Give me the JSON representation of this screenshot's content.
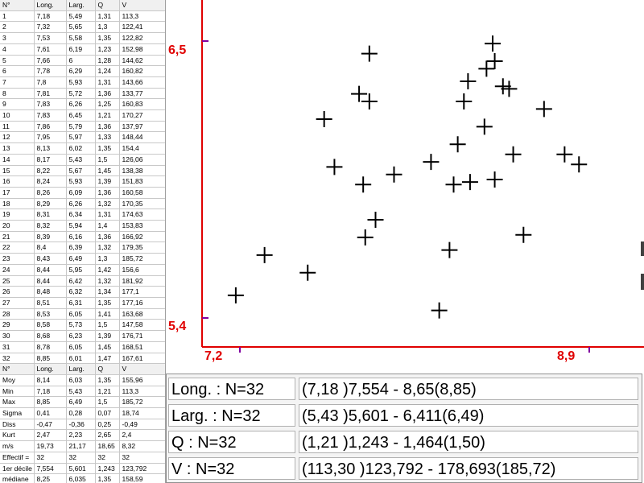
{
  "grid": {
    "header": [
      "N°",
      "Long.",
      "Larg.",
      "Q",
      "V"
    ],
    "rows": [
      [
        "1",
        "7,18",
        "5,49",
        "1,31",
        "113,3"
      ],
      [
        "2",
        "7,32",
        "5,65",
        "1,3",
        "122,41"
      ],
      [
        "3",
        "7,53",
        "5,58",
        "1,35",
        "122,82"
      ],
      [
        "4",
        "7,61",
        "6,19",
        "1,23",
        "152,98"
      ],
      [
        "5",
        "7,66",
        "6",
        "1,28",
        "144,62"
      ],
      [
        "6",
        "7,78",
        "6,29",
        "1,24",
        "160,82"
      ],
      [
        "7",
        "7,8",
        "5,93",
        "1,31",
        "143,66"
      ],
      [
        "8",
        "7,81",
        "5,72",
        "1,36",
        "133,77"
      ],
      [
        "9",
        "7,83",
        "6,26",
        "1,25",
        "160,83"
      ],
      [
        "10",
        "7,83",
        "6,45",
        "1,21",
        "170,27"
      ],
      [
        "11",
        "7,86",
        "5,79",
        "1,36",
        "137,97"
      ],
      [
        "12",
        "7,95",
        "5,97",
        "1,33",
        "148,44"
      ],
      [
        "13",
        "8,13",
        "6,02",
        "1,35",
        "154,4"
      ],
      [
        "14",
        "8,17",
        "5,43",
        "1,5",
        "126,06"
      ],
      [
        "15",
        "8,22",
        "5,67",
        "1,45",
        "138,38"
      ],
      [
        "16",
        "8,24",
        "5,93",
        "1,39",
        "151,83"
      ],
      [
        "17",
        "8,26",
        "6,09",
        "1,36",
        "160,58"
      ],
      [
        "18",
        "8,29",
        "6,26",
        "1,32",
        "170,35"
      ],
      [
        "19",
        "8,31",
        "6,34",
        "1,31",
        "174,63"
      ],
      [
        "20",
        "8,32",
        "5,94",
        "1,4",
        "153,83"
      ],
      [
        "21",
        "8,39",
        "6,16",
        "1,36",
        "166,92"
      ],
      [
        "22",
        "8,4",
        "6,39",
        "1,32",
        "179,35"
      ],
      [
        "23",
        "8,43",
        "6,49",
        "1,3",
        "185,72"
      ],
      [
        "24",
        "8,44",
        "5,95",
        "1,42",
        "156,6"
      ],
      [
        "25",
        "8,44",
        "6,42",
        "1,32",
        "181,92"
      ],
      [
        "26",
        "8,48",
        "6,32",
        "1,34",
        "177,1"
      ],
      [
        "27",
        "8,51",
        "6,31",
        "1,35",
        "177,16"
      ],
      [
        "28",
        "8,53",
        "6,05",
        "1,41",
        "163,68"
      ],
      [
        "29",
        "8,58",
        "5,73",
        "1,5",
        "147,58"
      ],
      [
        "30",
        "8,68",
        "6,23",
        "1,39",
        "176,71"
      ],
      [
        "31",
        "8,78",
        "6,05",
        "1,45",
        "168,51"
      ],
      [
        "32",
        "8,85",
        "6,01",
        "1,47",
        "167,61"
      ]
    ],
    "stats_header": [
      "N°",
      "Long.",
      "Larg.",
      "Q",
      "V"
    ],
    "stats_rows": [
      [
        "Moy",
        "8,14",
        "6,03",
        "1,35",
        "155,96"
      ],
      [
        "Min",
        "7,18",
        "5,43",
        "1,21",
        "113,3"
      ],
      [
        "Max",
        "8,85",
        "6,49",
        "1,5",
        "185,72"
      ],
      [
        "Sigma",
        "0,41",
        "0,28",
        "0,07",
        "18,74"
      ],
      [
        "Diss",
        "-0,47",
        "-0,36",
        "0,25",
        "-0,49"
      ],
      [
        "Kurt",
        "2,47",
        "2,23",
        "2,65",
        "2,4"
      ],
      [
        "m/s",
        "19,73",
        "21,17",
        "18,65",
        "8,32"
      ],
      [
        "Effectif =",
        "32",
        "32",
        "32",
        "32"
      ],
      [
        "1er décile",
        "7,554",
        "5,601",
        "1,243",
        "123,792"
      ],
      [
        "médiane",
        "8,25",
        "6,035",
        "1,35",
        "158,59"
      ],
      [
        "9ème décile",
        "8,65",
        "6,411",
        "1,464",
        "178,693"
      ]
    ]
  },
  "chart_data": {
    "type": "scatter",
    "x_tick_labels": [
      "7,2",
      "8,9"
    ],
    "y_tick_labels": [
      "6,5",
      "5,4"
    ],
    "xlim": [
      7.2,
      8.9
    ],
    "ylim": [
      5.4,
      6.5
    ],
    "grid": false,
    "x": [
      7.18,
      7.32,
      7.53,
      7.61,
      7.66,
      7.78,
      7.8,
      7.81,
      7.83,
      7.83,
      7.86,
      7.95,
      8.13,
      8.17,
      8.22,
      8.24,
      8.26,
      8.29,
      8.31,
      8.32,
      8.39,
      8.4,
      8.43,
      8.44,
      8.44,
      8.48,
      8.51,
      8.53,
      8.58,
      8.68,
      8.78,
      8.85
    ],
    "y": [
      5.49,
      5.65,
      5.58,
      6.19,
      6,
      6.29,
      5.93,
      5.72,
      6.26,
      6.45,
      5.79,
      5.97,
      6.02,
      5.43,
      5.67,
      5.93,
      6.09,
      6.26,
      6.34,
      5.94,
      6.16,
      6.39,
      6.49,
      5.95,
      6.42,
      6.32,
      6.31,
      6.05,
      5.73,
      6.23,
      6.05,
      6.01
    ],
    "colors": {
      "axes": "#e00000",
      "marker": "#000000"
    }
  },
  "stats_panel": [
    {
      "name": "Long. : N=32",
      "values": "(7,18 )7,554 - 8,65(8,85)"
    },
    {
      "name": "Larg. : N=32",
      "values": "(5,43 )5,601 - 6,411(6,49)"
    },
    {
      "name": "Q : N=32",
      "values": "(1,21 )1,243 - 1,464(1,50)"
    },
    {
      "name": "V : N=32",
      "values": "(113,30 )123,792 - 178,693(185,72)"
    }
  ]
}
